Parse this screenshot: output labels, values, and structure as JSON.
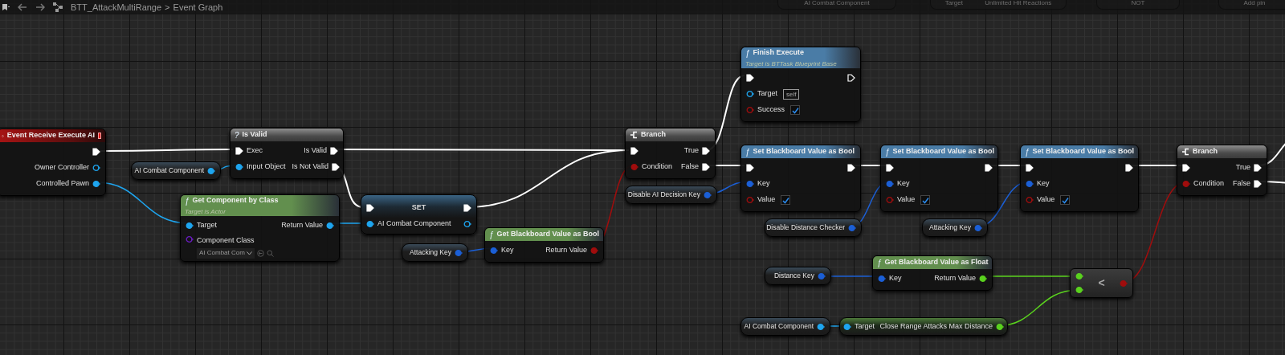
{
  "breadcrumb": {
    "asset": "BTT_AttackMultiRange",
    "separator": ">",
    "graph": "Event Graph"
  },
  "background_nodes": [
    {
      "texts": [
        "AI Combat Component"
      ]
    },
    {
      "texts": [
        "Target",
        "Unlimited Hit Reactions"
      ]
    },
    {
      "texts": [
        "NOT"
      ]
    },
    {
      "texts": [
        "Add pin"
      ]
    }
  ],
  "nodes": [
    {
      "kind": "event",
      "title": "Event Receive Execute AI",
      "outputs": [
        {
          "kind": "exec",
          "connected": true
        },
        {
          "kind": "data",
          "label": "Owner Controller",
          "color": "#1ea5ef",
          "connected": false
        },
        {
          "kind": "data",
          "label": "Controlled Pawn",
          "color": "#1ea5ef",
          "connected": true
        }
      ]
    },
    {
      "kind": "macro",
      "glyph": "?",
      "title": "Is Valid",
      "inputs": [
        {
          "kind": "exec",
          "label": "Exec",
          "connected": true
        },
        {
          "kind": "data",
          "label": "Input Object",
          "color": "#1ea5ef",
          "connected": true
        }
      ],
      "outputs": [
        {
          "kind": "exec",
          "label": "Is Valid",
          "connected": true
        },
        {
          "kind": "exec",
          "label": "Is Not Valid",
          "connected": true
        }
      ]
    },
    {
      "kind": "variable",
      "label": "AI Combat Component",
      "pin": {
        "kind": "data",
        "color": "#1ea5ef",
        "connected": true
      }
    },
    {
      "kind": "function",
      "color": "#628f4e",
      "glyph": "ƒ",
      "title": "Get Component by Class",
      "subtitle": "Target is Actor",
      "inputs": [
        {
          "kind": "data",
          "label": "Target",
          "color": "#1ea5ef",
          "connected": true
        },
        {
          "kind": "data",
          "label": "Component Class",
          "color": "#6a1cc0",
          "connected": false,
          "dropdown": "AI Combat Com"
        }
      ],
      "outputs": [
        {
          "kind": "data",
          "label": "Return Value",
          "color": "#1ea5ef",
          "connected": true
        }
      ]
    },
    {
      "kind": "set",
      "title": "SET",
      "inputs": [
        {
          "kind": "exec",
          "connected": true
        },
        {
          "kind": "data",
          "label": "AI Combat Component",
          "color": "#1ea5ef",
          "connected": true
        }
      ],
      "outputs": [
        {
          "kind": "exec",
          "connected": true
        },
        {
          "kind": "data",
          "color": "#1ea5ef",
          "connected": false
        }
      ]
    },
    {
      "kind": "variable",
      "label": "Attacking Key",
      "pin": {
        "kind": "data",
        "color": "#1b5fd6",
        "connected": true
      }
    },
    {
      "kind": "function",
      "color": "#628f4e",
      "glyph": "ƒ",
      "title": "Get Blackboard Value as Bool",
      "inputs": [
        {
          "kind": "data",
          "label": "Key",
          "color": "#1b5fd6",
          "connected": true
        }
      ],
      "outputs": [
        {
          "kind": "data",
          "label": "Return Value",
          "color": "#a00d0d",
          "connected": true
        }
      ]
    },
    {
      "kind": "branch",
      "title": "Branch",
      "inputs": [
        {
          "kind": "exec",
          "connected": true
        },
        {
          "kind": "data",
          "label": "Condition",
          "color": "#a00d0d",
          "connected": true
        }
      ],
      "outputs": [
        {
          "kind": "exec",
          "label": "True",
          "connected": true
        },
        {
          "kind": "exec",
          "label": "False",
          "connected": true
        }
      ]
    },
    {
      "kind": "function",
      "color": "#4a7ca6",
      "glyph": "ƒ",
      "title": "Finish Execute",
      "subtitle": "Target is BTTask Blueprint Base",
      "inputs": [
        {
          "kind": "exec",
          "connected": true
        },
        {
          "kind": "data",
          "label": "Target",
          "color": "#1ea5ef",
          "connected": false,
          "default": "self"
        },
        {
          "kind": "data",
          "label": "Success",
          "color": "#a00d0d",
          "connected": false,
          "checked": true
        }
      ],
      "outputs": [
        {
          "kind": "exec",
          "connected": false
        }
      ]
    },
    {
      "kind": "variable",
      "label": "Disable AI Decision Key",
      "pin": {
        "kind": "data",
        "color": "#1b5fd6",
        "connected": true
      }
    },
    {
      "kind": "function",
      "color": "#4a7ca6",
      "glyph": "ƒ",
      "title": "Set Blackboard Value as Bool",
      "inputs": [
        {
          "kind": "exec",
          "connected": true
        },
        {
          "kind": "data",
          "label": "Key",
          "color": "#1b5fd6",
          "connected": true
        },
        {
          "kind": "data",
          "label": "Value",
          "color": "#a00d0d",
          "connected": false,
          "checked": true
        }
      ],
      "outputs": [
        {
          "kind": "exec",
          "connected": true
        }
      ]
    },
    {
      "kind": "variable",
      "label": "Disable Distance Checker",
      "pin": {
        "kind": "data",
        "color": "#1b5fd6",
        "connected": true
      }
    },
    {
      "kind": "function",
      "color": "#4a7ca6",
      "glyph": "ƒ",
      "title": "Set Blackboard Value as Bool",
      "inputs": [
        {
          "kind": "exec",
          "connected": true
        },
        {
          "kind": "data",
          "label": "Key",
          "color": "#1b5fd6",
          "connected": true
        },
        {
          "kind": "data",
          "label": "Value",
          "color": "#a00d0d",
          "connected": false,
          "checked": true
        }
      ],
      "outputs": [
        {
          "kind": "exec",
          "connected": true
        }
      ]
    },
    {
      "kind": "function",
      "color": "#4a7ca6",
      "glyph": "ƒ",
      "title": "Set Blackboard Value as Bool",
      "inputs": [
        {
          "kind": "exec",
          "connected": true
        },
        {
          "kind": "data",
          "label": "Key",
          "color": "#1b5fd6",
          "connected": true
        },
        {
          "kind": "data",
          "label": "Value",
          "color": "#a00d0d",
          "connected": false,
          "checked": true
        }
      ],
      "outputs": [
        {
          "kind": "exec",
          "connected": true
        }
      ]
    },
    {
      "kind": "variable",
      "label": "Attacking Key",
      "pin": {
        "kind": "data",
        "color": "#1b5fd6",
        "connected": true
      }
    },
    {
      "kind": "branch",
      "title": "Branch",
      "inputs": [
        {
          "kind": "exec",
          "connected": true
        },
        {
          "kind": "data",
          "label": "Condition",
          "color": "#a00d0d",
          "connected": true
        }
      ],
      "outputs": [
        {
          "kind": "exec",
          "label": "True",
          "connected": true
        },
        {
          "kind": "exec",
          "label": "False",
          "connected": true
        }
      ]
    },
    {
      "kind": "variable",
      "label": "Distance Key",
      "pin": {
        "kind": "data",
        "color": "#1b5fd6",
        "connected": true
      }
    },
    {
      "kind": "function",
      "color": "#628f4e",
      "glyph": "ƒ",
      "title": "Get Blackboard Value as Float",
      "inputs": [
        {
          "kind": "data",
          "label": "Key",
          "color": "#1b5fd6",
          "connected": true
        }
      ],
      "outputs": [
        {
          "kind": "data",
          "label": "Return Value",
          "color": "#5ad21e",
          "connected": true
        }
      ]
    },
    {
      "kind": "operator",
      "symbol": "<",
      "inputs": [
        {
          "kind": "data",
          "color": "#5ad21e",
          "connected": true
        },
        {
          "kind": "data",
          "color": "#5ad21e",
          "connected": true
        }
      ],
      "outputs": [
        {
          "kind": "data",
          "color": "#a00d0d",
          "connected": true
        }
      ]
    },
    {
      "kind": "variable",
      "label": "AI Combat Component",
      "pin": {
        "kind": "data",
        "color": "#1ea5ef",
        "connected": true
      }
    },
    {
      "kind": "getter",
      "inputs": [
        {
          "kind": "data",
          "label": "Target",
          "color": "#1ea5ef",
          "connected": true
        }
      ],
      "outputs": [
        {
          "kind": "data",
          "label": "Close Range Attacks Max Distance",
          "color": "#5ad21e",
          "connected": true
        }
      ]
    }
  ]
}
